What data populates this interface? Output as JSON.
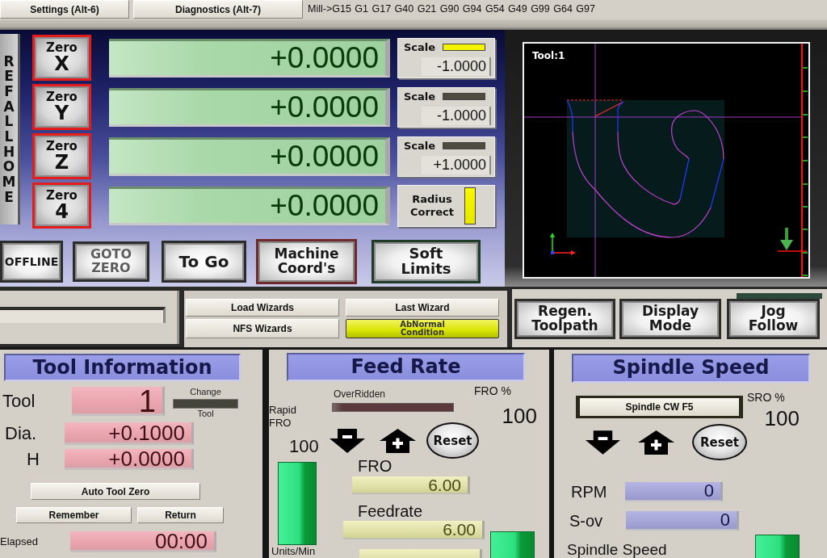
{
  "top_bar": {
    "page_buttons": [
      "Settings (Alt-6)",
      "Diagnostics (Alt-7)"
    ],
    "gcode_status": "Mill->G15 G1 G17 G40 G21 G90 G94 G54 G49 G99 G64 G97"
  },
  "dro": {
    "ref_all_home": "REF ALL HOME",
    "axes": [
      {
        "zero": "Zero",
        "axis": "X",
        "value": "+0.0000"
      },
      {
        "zero": "Zero",
        "axis": "Y",
        "value": "+0.0000"
      },
      {
        "zero": "Zero",
        "axis": "Z",
        "value": "+0.0000"
      },
      {
        "zero": "Zero",
        "axis": "4",
        "value": "+0.0000"
      }
    ],
    "side_boxes": [
      {
        "kind": "scale",
        "label": "Scale",
        "on": true,
        "value": "-1.0000"
      },
      {
        "kind": "scale",
        "label": "Scale",
        "on": false,
        "value": "-1.0000"
      },
      {
        "kind": "scale",
        "label": "Scale",
        "on": false,
        "value": "+1.0000"
      },
      {
        "kind": "toggle",
        "label": "Radius Correct",
        "on": true
      }
    ],
    "buttons": [
      {
        "label": "OFFLINE",
        "kind": "plain"
      },
      {
        "label": "GOTO ZERO",
        "kind": "embossed"
      },
      {
        "label": "To Go",
        "kind": "plain"
      },
      {
        "label": "Machine Coord's",
        "kind": "plain"
      },
      {
        "label": "Soft Limits",
        "kind": "plain"
      }
    ]
  },
  "toolpath": {
    "tool_label": "Tool:1"
  },
  "wizards": {
    "buttons": [
      "Load Wizards",
      "Last Wizard",
      "NFS Wizards"
    ],
    "abnormal_condition": {
      "label": "AbNormal Condition",
      "on": true
    }
  },
  "view_buttons": {
    "follow_led_on": false,
    "buttons": [
      "Regen. Toolpath",
      "Display Mode",
      "Jog Follow"
    ]
  },
  "tool_info": {
    "title": "Tool Information",
    "tool_label": "Tool",
    "tool_value": "1",
    "change_top": "Change",
    "change_bottom": "Tool",
    "change_led_on": false,
    "dia_label": "Dia.",
    "dia_value": "+0.1000",
    "h_label": "H",
    "h_value": "+0.0000",
    "buttons": [
      "Auto Tool Zero",
      "Remember",
      "Return"
    ],
    "elapsed_label": "Elapsed",
    "elapsed_value": "00:00"
  },
  "feed_rate": {
    "title": "Feed Rate",
    "overridden_label": "OverRidden",
    "overridden_on": false,
    "fro_pct_label": "FRO %",
    "fro_pct_value": "100",
    "rapid_label": "Rapid FRO",
    "rapid_value": "100",
    "reset": "Reset",
    "fro_label": "FRO",
    "fro_value": "6.00",
    "feedrate_label": "Feedrate",
    "feedrate_value": "6.00",
    "units_label": "Units/Min"
  },
  "spindle": {
    "title": "Spindle Speed",
    "cw_button": "Spindle CW F5",
    "sro_label": "SRO %",
    "sro_value": "100",
    "reset": "Reset",
    "rpm_label": "RPM",
    "rpm_value": "0",
    "sov_label": "S-ov",
    "sov_value": "0",
    "speed_label": "Spindle Speed"
  }
}
